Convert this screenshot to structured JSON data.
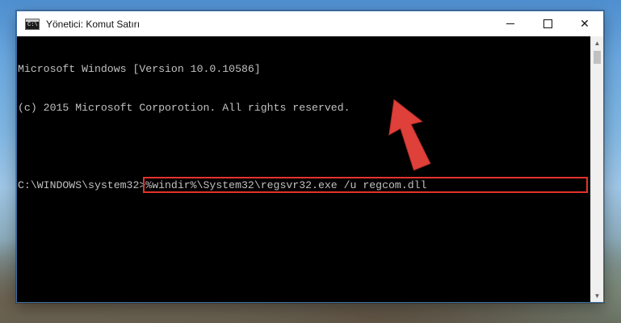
{
  "window": {
    "title": "Yönetici: Komut Satırı",
    "icon_label": "C:\\",
    "controls": {
      "minimize": "minimize",
      "maximize": "maximize",
      "close": "✕"
    }
  },
  "console": {
    "lines": [
      "Microsoft Windows [Version 10.0.10586]",
      "(c) 2015 Microsoft Corporotion. All rights reserved."
    ],
    "prompt": "C:\\WINDOWS\\system32>",
    "command": "%windir%\\System32\\regsvr32.exe /u regcom.dll"
  },
  "annotation": {
    "highlight_color": "#e3332c",
    "arrow_color": "#e0403a"
  },
  "icons": [
    "cmd-app-icon",
    "minimize-icon",
    "maximize-icon",
    "close-icon",
    "scroll-up-icon",
    "scroll-down-icon",
    "red-arrow-icon"
  ]
}
